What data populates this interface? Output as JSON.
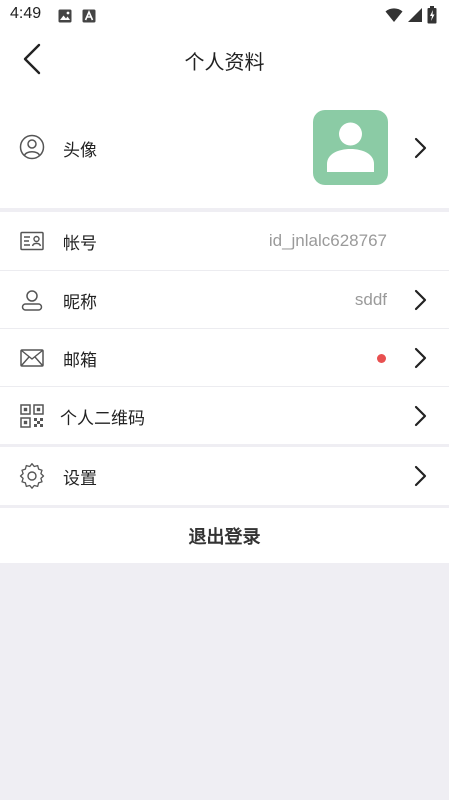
{
  "status_bar": {
    "time": "4:49",
    "left_icons": [
      "image-icon",
      "a-badge-icon"
    ],
    "right_icons": [
      "wifi-icon",
      "signal-icon",
      "battery-charging-icon"
    ]
  },
  "header": {
    "title": "个人资料",
    "back_icon": "back-chevron-icon"
  },
  "profile": {
    "avatar": {
      "label": "头像",
      "icon": "user-circle-icon",
      "image_color": "#8bcba5"
    },
    "account": {
      "label": "帐号",
      "value": "id_jnlalc628767",
      "icon": "id-card-icon"
    },
    "nickname": {
      "label": "昵称",
      "value": "sddf",
      "icon": "person-icon"
    },
    "email": {
      "label": "邮箱",
      "icon": "mail-icon",
      "indicator_color": "#e85050"
    },
    "qrcode": {
      "label": "个人二维码",
      "icon": "qrcode-icon"
    },
    "settings": {
      "label": "设置",
      "icon": "gear-icon"
    }
  },
  "actions": {
    "logout_label": "退出登录"
  }
}
